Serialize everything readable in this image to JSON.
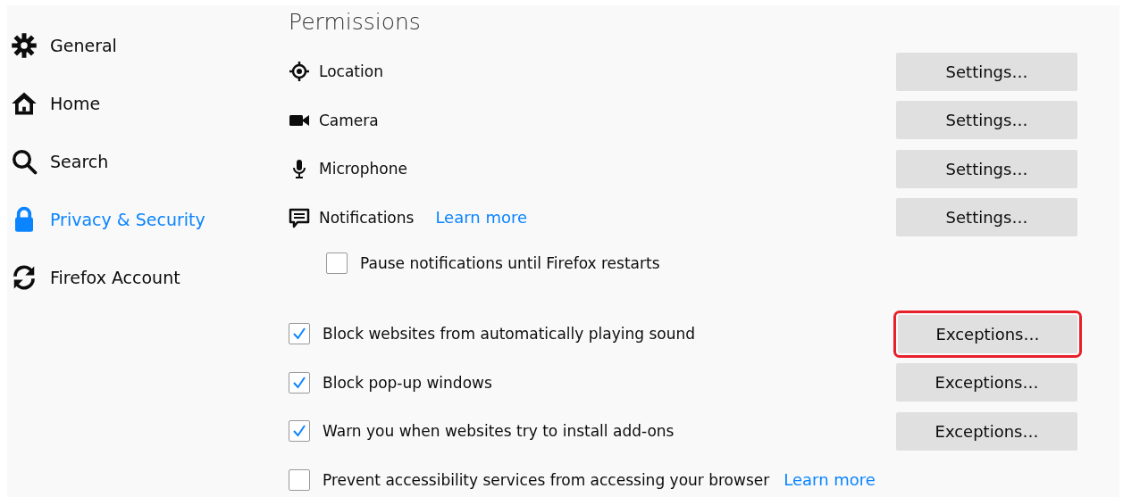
{
  "sidebar": {
    "items": [
      {
        "label": "General",
        "selected": false
      },
      {
        "label": "Home",
        "selected": false
      },
      {
        "label": "Search",
        "selected": false
      },
      {
        "label": "Privacy & Security",
        "selected": true
      },
      {
        "label": "Firefox Account",
        "selected": false
      }
    ]
  },
  "permissions": {
    "title": "Permissions",
    "items": [
      {
        "label": "Location",
        "button": "Settings…"
      },
      {
        "label": "Camera",
        "button": "Settings…"
      },
      {
        "label": "Microphone",
        "button": "Settings…"
      },
      {
        "label": "Notifications",
        "link": "Learn more",
        "button": "Settings…"
      }
    ],
    "pause": {
      "label": "Pause notifications until Firefox restarts",
      "checked": false
    },
    "options": [
      {
        "label": "Block websites from automatically playing sound",
        "checked": true,
        "button": "Exceptions…",
        "highlighted": true
      },
      {
        "label": "Block pop-up windows",
        "checked": true,
        "button": "Exceptions…",
        "highlighted": false
      },
      {
        "label": "Warn you when websites try to install add-ons",
        "checked": true,
        "button": "Exceptions…",
        "highlighted": false
      },
      {
        "label": "Prevent accessibility services from accessing your browser",
        "checked": false,
        "link": "Learn more"
      }
    ]
  }
}
